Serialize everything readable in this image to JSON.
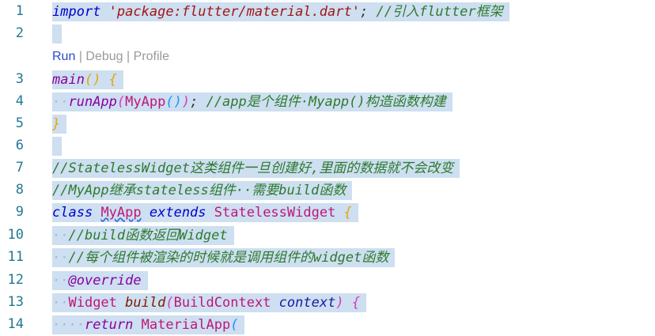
{
  "editor": {
    "code_lens": {
      "run": "Run",
      "sep1": "|",
      "debug": "Debug",
      "sep2": "|",
      "profile": "Profile"
    },
    "lines": [
      {
        "n": "1",
        "parts": [
          {
            "t": "import",
            "c": "kw"
          },
          {
            "t": " ",
            "c": "pl"
          },
          {
            "t": "'package:flutter/material.dart'",
            "c": "str"
          },
          {
            "t": ";",
            "c": "pl"
          },
          {
            "t": " ",
            "c": "pl"
          },
          {
            "t": "//引入flutter框架",
            "c": "cm"
          }
        ]
      },
      {
        "n": "2",
        "parts": []
      },
      {
        "n": "3",
        "parts": [
          {
            "t": "main",
            "c": "ctl"
          },
          {
            "t": "()",
            "c": "br1"
          },
          {
            "t": " ",
            "c": "pl"
          },
          {
            "t": "{",
            "c": "br1"
          }
        ]
      },
      {
        "n": "4",
        "parts": [
          {
            "t": "··",
            "c": "ws"
          },
          {
            "t": "runApp",
            "c": "ctl"
          },
          {
            "t": "(",
            "c": "br2"
          },
          {
            "t": "MyApp",
            "c": "cls"
          },
          {
            "t": "()",
            "c": "br3"
          },
          {
            "t": ")",
            "c": "br2"
          },
          {
            "t": ";",
            "c": "pl"
          },
          {
            "t": " ",
            "c": "pl"
          },
          {
            "t": "//app是个组件·Myapp()构造函数构建",
            "c": "cm"
          }
        ]
      },
      {
        "n": "5",
        "parts": [
          {
            "t": "}",
            "c": "br1"
          }
        ]
      },
      {
        "n": "6",
        "parts": []
      },
      {
        "n": "7",
        "parts": [
          {
            "t": "//StatelessWidget这类组件一旦创建好,里面的数据就不会改变",
            "c": "cm"
          }
        ]
      },
      {
        "n": "8",
        "parts": [
          {
            "t": "//MyApp继承stateless组件··需要build函数",
            "c": "cm"
          }
        ]
      },
      {
        "n": "9",
        "parts": [
          {
            "t": "class",
            "c": "kw"
          },
          {
            "t": " ",
            "c": "pl"
          },
          {
            "t": "MyApp",
            "c": "cls",
            "u": true
          },
          {
            "t": " ",
            "c": "pl"
          },
          {
            "t": "extends",
            "c": "kw"
          },
          {
            "t": " ",
            "c": "pl"
          },
          {
            "t": "StatelessWidget",
            "c": "cls"
          },
          {
            "t": " ",
            "c": "pl"
          },
          {
            "t": "{",
            "c": "br1"
          }
        ]
      },
      {
        "n": "10",
        "parts": [
          {
            "t": "··",
            "c": "ws"
          },
          {
            "t": "//build函数返回Widget",
            "c": "cm"
          }
        ]
      },
      {
        "n": "11",
        "parts": [
          {
            "t": "··",
            "c": "ws"
          },
          {
            "t": "//每个组件被渲染的时候就是调用组件的widget函数",
            "c": "cm"
          }
        ]
      },
      {
        "n": "12",
        "parts": [
          {
            "t": "··",
            "c": "ws"
          },
          {
            "t": "@override",
            "c": "ann"
          }
        ]
      },
      {
        "n": "13",
        "parts": [
          {
            "t": "··",
            "c": "ws"
          },
          {
            "t": "Widget",
            "c": "cls"
          },
          {
            "t": " ",
            "c": "pl"
          },
          {
            "t": "build",
            "c": "fn"
          },
          {
            "t": "(",
            "c": "br2"
          },
          {
            "t": "BuildContext",
            "c": "cls"
          },
          {
            "t": " ",
            "c": "pl"
          },
          {
            "t": "context",
            "c": "var"
          },
          {
            "t": ")",
            "c": "br2"
          },
          {
            "t": " ",
            "c": "pl"
          },
          {
            "t": "{",
            "c": "br2"
          }
        ]
      },
      {
        "n": "14",
        "parts": [
          {
            "t": "····",
            "c": "ws"
          },
          {
            "t": "return",
            "c": "ctl"
          },
          {
            "t": " ",
            "c": "pl"
          },
          {
            "t": "MaterialApp",
            "c": "cls"
          },
          {
            "t": "(",
            "c": "br3"
          }
        ]
      }
    ]
  }
}
